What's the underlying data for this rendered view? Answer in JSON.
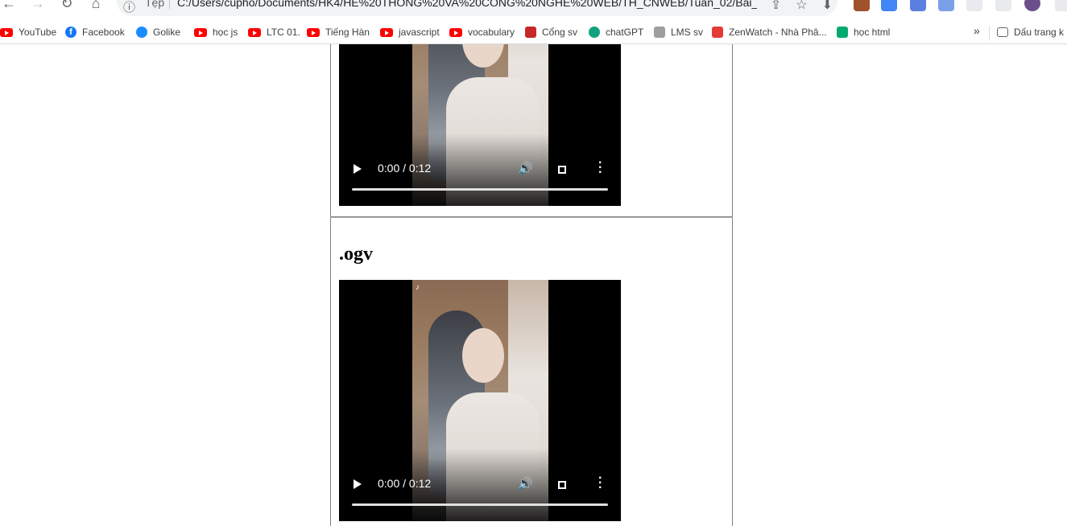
{
  "toolbar": {
    "back_icon": "back-arrow-icon",
    "forward_icon": "forward-arrow-icon",
    "reload_icon": "reload-icon",
    "home_icon": "home-icon",
    "scheme_label": "Tệp",
    "url": "C:/Users/cupho/Documents/HK4/HE%20THONG%20VA%20CONG%20NGHE%20WEB/TH_CNWEB/Tuan_02/Bai_ta..."
  },
  "bookmarks": [
    {
      "label": "YouTube",
      "icon": "youtube-icon"
    },
    {
      "label": "Facebook",
      "icon": "facebook-icon"
    },
    {
      "label": "Golike",
      "icon": "golike-icon"
    },
    {
      "label": "học js",
      "icon": "youtube-icon"
    },
    {
      "label": "LTC 01.",
      "icon": "youtube-icon"
    },
    {
      "label": "Tiếng Hàn",
      "icon": "youtube-icon"
    },
    {
      "label": "javascript",
      "icon": "youtube-icon"
    },
    {
      "label": "vocabulary",
      "icon": "youtube-icon"
    },
    {
      "label": "Cổng sv",
      "icon": "school-icon"
    },
    {
      "label": "chatGPT",
      "icon": "openai-icon"
    },
    {
      "label": "LMS sv",
      "icon": "lms-icon"
    },
    {
      "label": "ZenWatch - Nhà Phâ...",
      "icon": "zenwatch-icon"
    },
    {
      "label": "học html",
      "icon": "w3schools-icon"
    }
  ],
  "bookmarks_more": "»",
  "other_bookmarks": "Dấu trang k",
  "content": {
    "section_heading": ".ogv"
  },
  "videos": [
    {
      "time": "0:00 / 0:12",
      "progress": 0
    },
    {
      "time": "0:00 / 0:12",
      "progress": 0
    }
  ],
  "colors": {
    "youtube": "#ff0000",
    "facebook": "#1877f2",
    "table_border": "#808080"
  }
}
